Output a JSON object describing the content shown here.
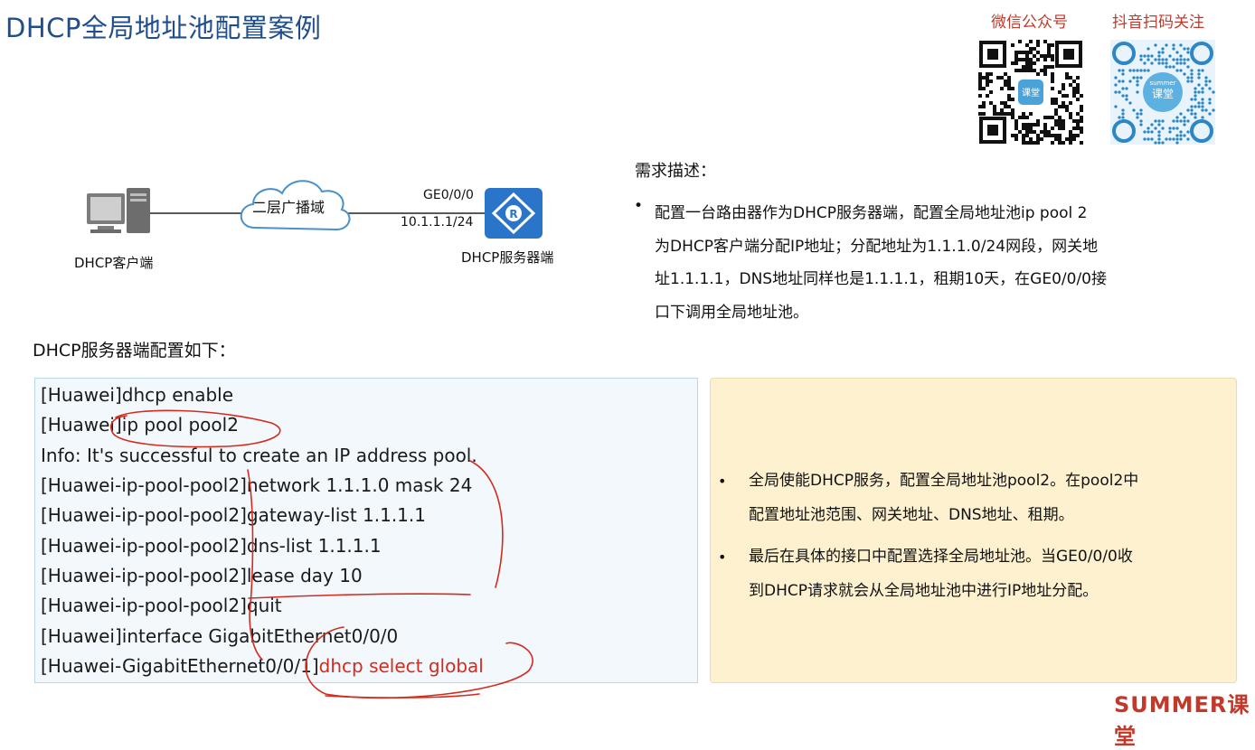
{
  "title": "DHCP全局地址池配置案例",
  "qr": {
    "wechat_label": "微信公众号",
    "douyin_label": "抖音扫码关注",
    "logo_text": "课堂",
    "logo_small": "summer"
  },
  "topology": {
    "client_label": "DHCP客户端",
    "cloud_label": "二层广播域",
    "interface_label": "GE0/0/0",
    "ip_label": "10.1.1.1/24",
    "server_label": "DHCP服务器端",
    "router_symbol": "R"
  },
  "requirement": {
    "title": "需求描述：",
    "bullet": "•",
    "lines": [
      "配置一台路由器作为DHCP服务器端，配置全局地址池ip pool 2",
      "为DHCP客户端分配IP地址；分配地址为1.1.1.0/24网段，网关地",
      "址1.1.1.1，DNS地址同样也是1.1.1.1，租期10天，在GE0/0/0接",
      "口下调用全局地址池。"
    ]
  },
  "config": {
    "title": "DHCP服务器端配置如下：",
    "lines": [
      "[Huawei]dhcp enable",
      "[Huawei]ip pool pool2",
      "Info: It's successful to create an IP address pool.",
      "[Huawei-ip-pool-pool2]network 1.1.1.0 mask 24",
      "[Huawei-ip-pool-pool2]gateway-list 1.1.1.1",
      "[Huawei-ip-pool-pool2]dns-list 1.1.1.1",
      "[Huawei-ip-pool-pool2]lease day 10",
      "[Huawei-ip-pool-pool2]quit",
      "[Huawei]interface GigabitEthernet0/0/0"
    ],
    "last_prefix": "[Huawei-GigabitEthernet0/0/1]",
    "last_command": "dhcp select global"
  },
  "notes": {
    "bullet": "•",
    "items": [
      [
        "全局使能DHCP服务，配置全局地址池pool2。在pool2中",
        "配置地址池范围、网关地址、DNS地址、租期。"
      ],
      [
        "最后在具体的接口中配置选择全局地址池。当GE0/0/0收",
        "到DHCP请求就会从全局地址池中进行IP地址分配。"
      ]
    ]
  },
  "brand": "SUMMER课堂",
  "colors": {
    "title": "#1f4e8c",
    "accent_red": "#d42b1e",
    "router_blue": "#2a74c9",
    "code_bg": "#f2f8fc",
    "notes_bg": "#fdf1cf"
  }
}
